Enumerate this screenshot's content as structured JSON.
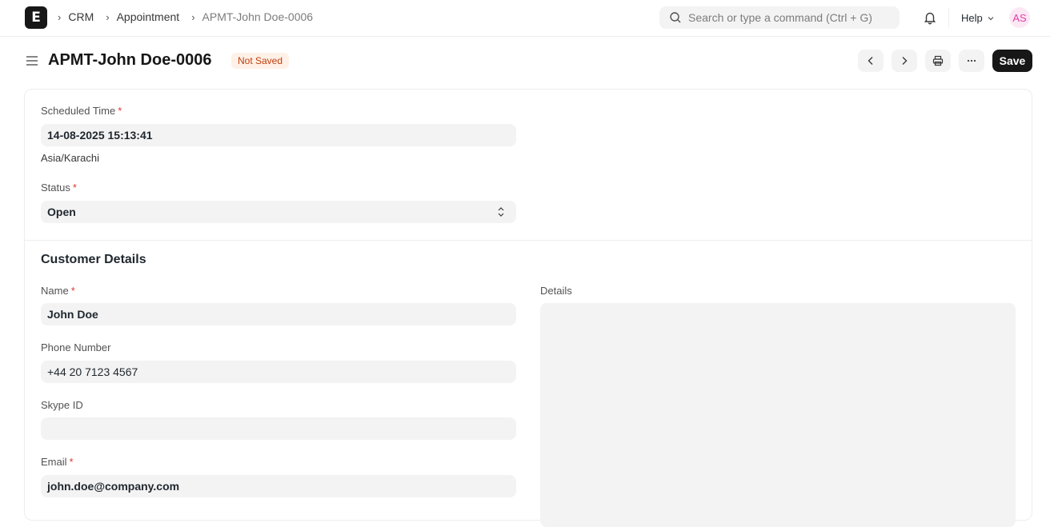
{
  "navbar": {
    "logo_letter": "E",
    "breadcrumbs": [
      "CRM",
      "Appointment",
      "APMT-John Doe-0006"
    ],
    "search_placeholder": "Search or type a command (Ctrl + G)",
    "help_label": "Help",
    "avatar_initials": "AS"
  },
  "page": {
    "title": "APMT-John Doe-0006",
    "status_badge": "Not Saved",
    "save_label": "Save"
  },
  "form": {
    "scheduled_time": {
      "label": "Scheduled Time",
      "value": "14-08-2025 15:13:41",
      "timezone": "Asia/Karachi"
    },
    "status": {
      "label": "Status",
      "value": "Open"
    },
    "customer_section_title": "Customer Details",
    "name": {
      "label": "Name",
      "value": "John Doe"
    },
    "phone": {
      "label": "Phone Number",
      "value": "+44 20 7123 4567"
    },
    "skype": {
      "label": "Skype ID",
      "value": ""
    },
    "email": {
      "label": "Email",
      "value": "john.doe@company.com"
    },
    "details": {
      "label": "Details",
      "value": ""
    }
  },
  "colors": {
    "primary_button": "#171717",
    "badge_bg": "#fff1e7",
    "badge_text": "#bd3e0c",
    "required_marker": "#e03636",
    "avatar_text": "#e040a8"
  }
}
